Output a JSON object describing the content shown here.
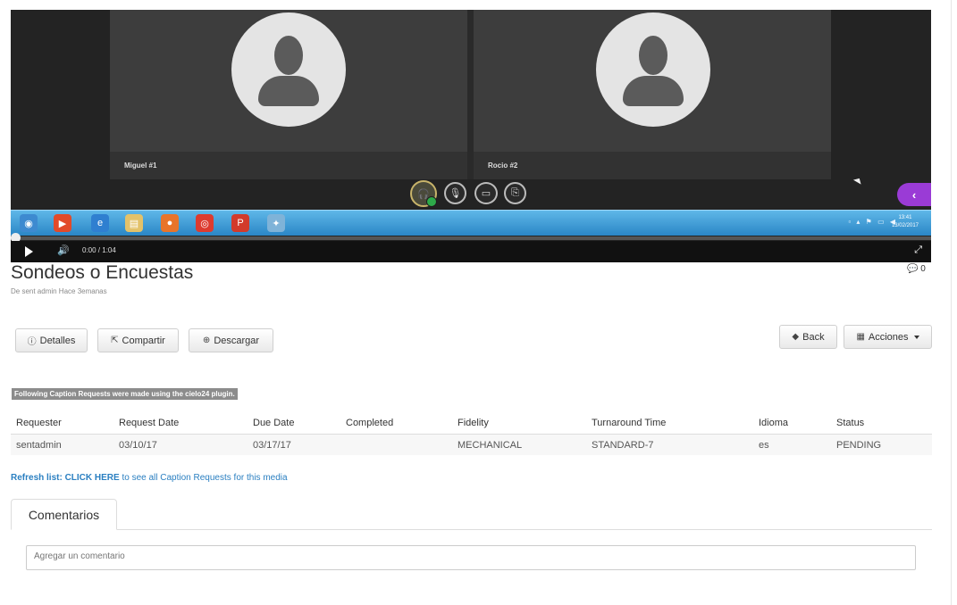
{
  "video": {
    "participants": [
      "Miguel #1",
      "Rocio #2"
    ],
    "time": "0:00 / 1:04",
    "clock_time": "13:41",
    "clock_date": "13/02/2017"
  },
  "page": {
    "title": "Sondeos o Encuestas",
    "byline": "De sent admin Hace 3emanas",
    "comment_count": "0"
  },
  "buttons": {
    "detalles": "Detalles",
    "compartir": "Compartir",
    "descargar": "Descargar",
    "back": "Back",
    "acciones": "Acciones"
  },
  "captions": {
    "notice": "Following Caption Requests were made using the cielo24 plugin.",
    "columns": [
      "Requester",
      "Request Date",
      "Due Date",
      "Completed",
      "Fidelity",
      "Turnaround Time",
      "Idioma",
      "Status"
    ],
    "rows": [
      [
        "sentadmin",
        "03/10/17",
        "03/17/17",
        "",
        "MECHANICAL",
        "STANDARD-7",
        "es",
        "PENDING"
      ]
    ],
    "refresh_bold": "Refresh list: CLICK HERE",
    "refresh_rest": " to see all Caption Requests for this media"
  },
  "comments": {
    "tab": "Comentarios",
    "placeholder": "Agregar un comentario"
  },
  "icons": {
    "info": "info-icon",
    "share": "share-icon",
    "download": "download-icon",
    "back": "arrow-left-icon",
    "actions": "list-icon",
    "comment": "comment-icon"
  },
  "colors": {
    "link": "#2a7fc1",
    "accent_purple": "#9a3bd6",
    "taskbar": "#2a86c6"
  }
}
